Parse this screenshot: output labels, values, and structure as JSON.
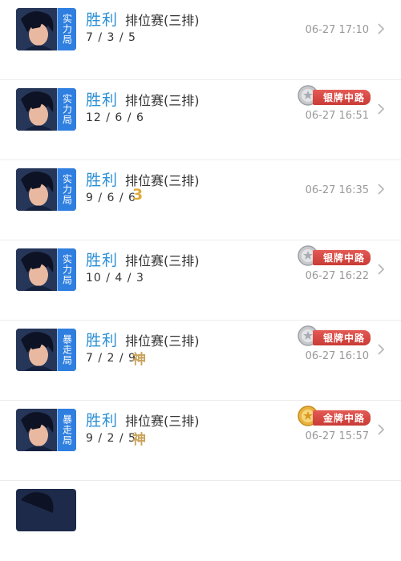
{
  "matches": [
    {
      "mode": "实力局",
      "result": "胜利",
      "type": "排位赛(三排)",
      "kda": "7 / 3 / 5",
      "mark": "",
      "badge": "",
      "badge_kind": "",
      "time": "06-27 17:10"
    },
    {
      "mode": "实力局",
      "result": "胜利",
      "type": "排位赛(三排)",
      "kda": "12 / 6 / 6",
      "mark": "",
      "badge": "银牌中路",
      "badge_kind": "silver",
      "time": "06-27 16:51"
    },
    {
      "mode": "实力局",
      "result": "胜利",
      "type": "排位赛(三排)",
      "kda": "9 / 6 / 6",
      "mark": "3",
      "badge": "",
      "badge_kind": "",
      "time": "06-27 16:35"
    },
    {
      "mode": "实力局",
      "result": "胜利",
      "type": "排位赛(三排)",
      "kda": "10 / 4 / 3",
      "mark": "",
      "badge": "银牌中路",
      "badge_kind": "silver",
      "time": "06-27 16:22"
    },
    {
      "mode": "暴走局",
      "result": "胜利",
      "type": "排位赛(三排)",
      "kda": "7 / 2 / 9",
      "mark": "神",
      "badge": "银牌中路",
      "badge_kind": "silver",
      "time": "06-27 16:10"
    },
    {
      "mode": "暴走局",
      "result": "胜利",
      "type": "排位赛(三排)",
      "kda": "9 / 2 / 5",
      "mark": "神",
      "badge": "金牌中路",
      "badge_kind": "gold",
      "time": "06-27 15:57"
    }
  ],
  "colors": {
    "result": "#2a8fd6",
    "mode_tag": "#2f7fe0",
    "silver_medal": "#c7c9cc",
    "gold_medal": "#e9b23c",
    "badge_ribbon": "#d9453f"
  },
  "icons": {
    "chevron": "chevron-right-icon",
    "avatar": "hero-avatar",
    "medal": "medal-icon"
  }
}
